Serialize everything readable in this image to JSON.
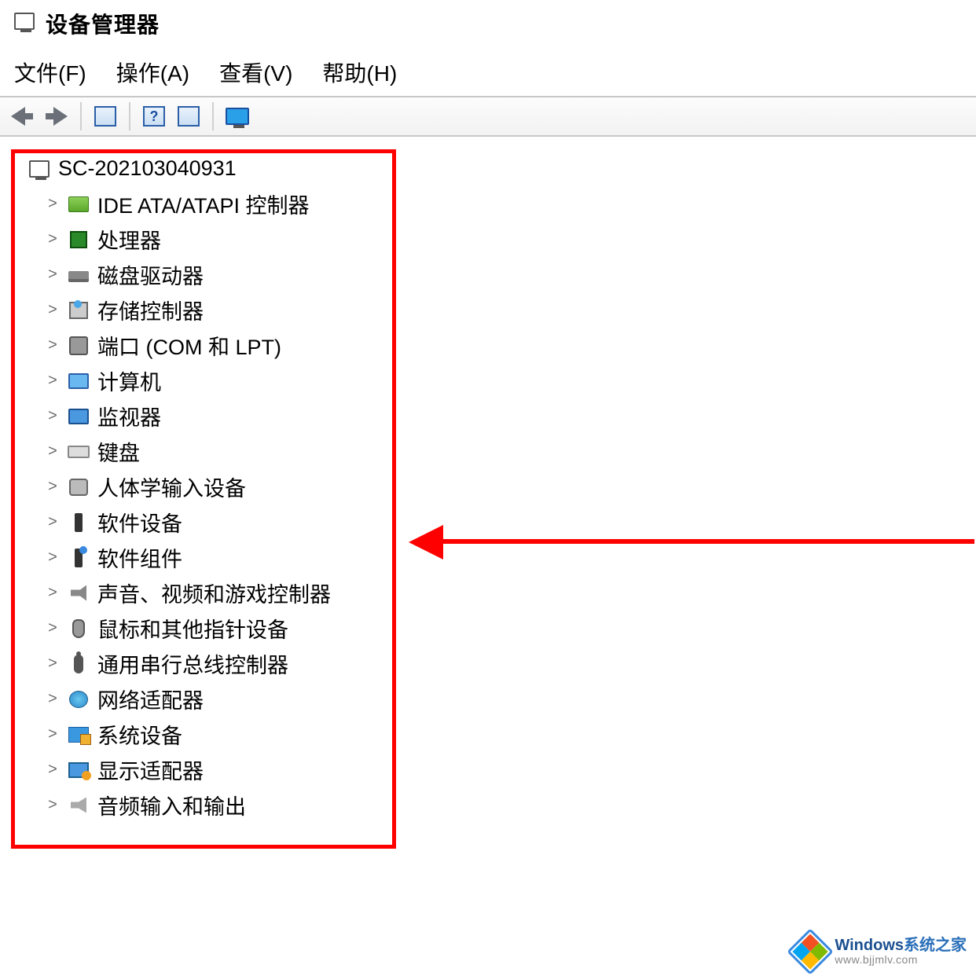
{
  "window": {
    "title": "设备管理器"
  },
  "menu": {
    "file": "文件(F)",
    "action": "操作(A)",
    "view": "查看(V)",
    "help": "帮助(H)"
  },
  "tree": {
    "root": "SC-202103040931",
    "items": [
      {
        "label": "IDE ATA/ATAPI 控制器",
        "icon": "ic-card"
      },
      {
        "label": "处理器",
        "icon": "ic-chip"
      },
      {
        "label": "磁盘驱动器",
        "icon": "ic-disk"
      },
      {
        "label": "存储控制器",
        "icon": "ic-storage"
      },
      {
        "label": "端口 (COM 和 LPT)",
        "icon": "ic-port"
      },
      {
        "label": "计算机",
        "icon": "ic-monitor"
      },
      {
        "label": "监视器",
        "icon": "ic-monitor2"
      },
      {
        "label": "键盘",
        "icon": "ic-kb"
      },
      {
        "label": "人体学输入设备",
        "icon": "ic-hid"
      },
      {
        "label": "软件设备",
        "icon": "ic-sw"
      },
      {
        "label": "软件组件",
        "icon": "ic-sw2"
      },
      {
        "label": "声音、视频和游戏控制器",
        "icon": "ic-speaker"
      },
      {
        "label": "鼠标和其他指针设备",
        "icon": "ic-mouse"
      },
      {
        "label": "通用串行总线控制器",
        "icon": "ic-usb"
      },
      {
        "label": "网络适配器",
        "icon": "ic-net"
      },
      {
        "label": "系统设备",
        "icon": "ic-sys"
      },
      {
        "label": "显示适配器",
        "icon": "ic-display"
      },
      {
        "label": "音频输入和输出",
        "icon": "ic-audio"
      }
    ]
  },
  "watermark": {
    "brand_prefix": "Windows",
    "brand_suffix": "系统之家",
    "url": "www.bjjmlv.com"
  }
}
